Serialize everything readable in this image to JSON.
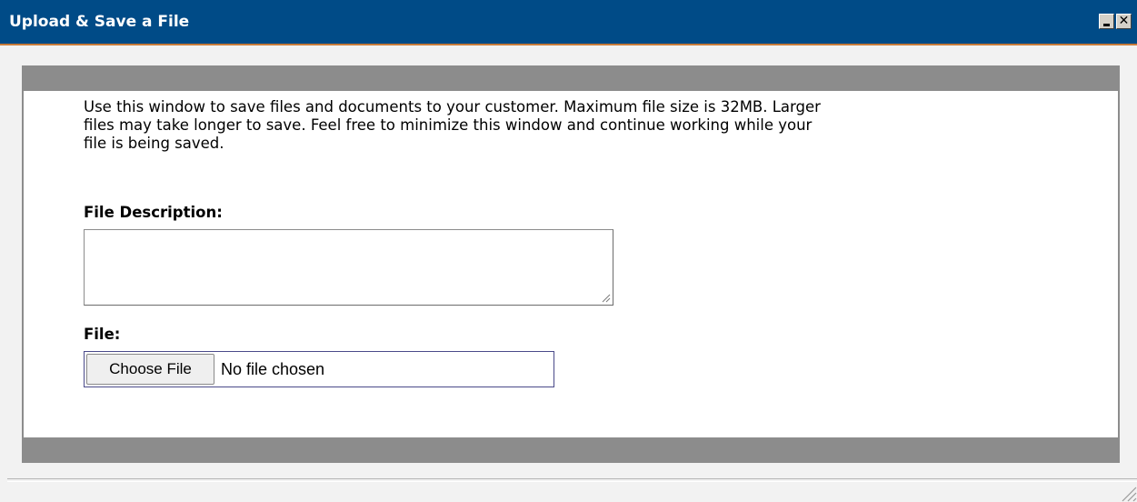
{
  "window": {
    "title": "Upload & Save a File",
    "colors": {
      "titlebar": "#004b87",
      "panel_bars": "#8c8c8c"
    }
  },
  "content": {
    "intro_line1": "Use this window to save files and documents to your customer. Maximum file size is 32MB. Larger",
    "intro_line2": "files may take longer to save. Feel free to minimize this window and continue working while your",
    "intro_line3": "file is being saved.",
    "description_label": "File Description:",
    "description_value": "",
    "file_label": "File:",
    "choose_file_button": "Choose File",
    "no_file_text": "No file chosen"
  },
  "icons": {
    "minimize": "minimize-icon",
    "close": "close-icon",
    "resize": "resize-grip-icon"
  }
}
